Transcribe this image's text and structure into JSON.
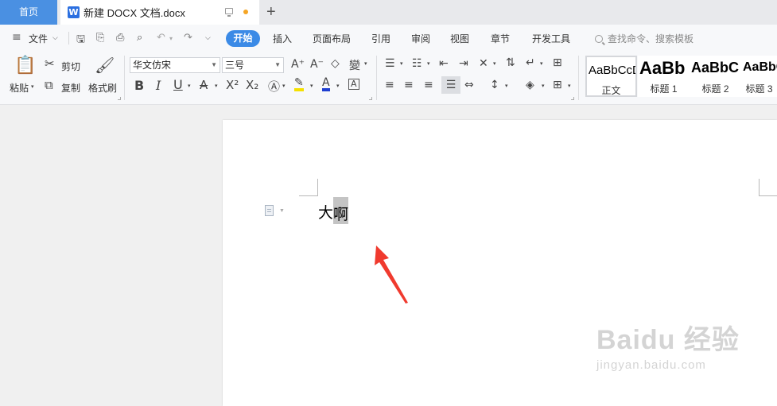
{
  "tabs": {
    "home": "首页",
    "document": "新建 DOCX 文档.docx",
    "new_tab": "+"
  },
  "menu": {
    "file": "文件",
    "items": [
      "开始",
      "插入",
      "页面布局",
      "引用",
      "审阅",
      "视图",
      "章节",
      "开发工具"
    ],
    "search_placeholder": "查找命令、搜索模板"
  },
  "ribbon": {
    "paste": "粘贴",
    "cut": "剪切",
    "copy": "复制",
    "format_painter": "格式刷",
    "font_name": "华文仿宋",
    "font_size": "三号",
    "styles": [
      {
        "sample": "AaBbCcDd",
        "label": "正文"
      },
      {
        "sample": "AaBb",
        "label": "标题 1"
      },
      {
        "sample": "AaBbC",
        "label": "标题 2"
      },
      {
        "sample": "AaBbC",
        "label": "标题 3"
      }
    ]
  },
  "document": {
    "text_normal": "大",
    "text_selected": "啊"
  },
  "watermark": {
    "logo": "Baidu 经验",
    "url": "jingyan.baidu.com"
  },
  "colors": {
    "accent": "#3b8ae6",
    "home_tab": "#4a90e2",
    "highlight": "#f5e000",
    "font_color": "#1f3fd1",
    "arrow": "#f03a2e"
  }
}
